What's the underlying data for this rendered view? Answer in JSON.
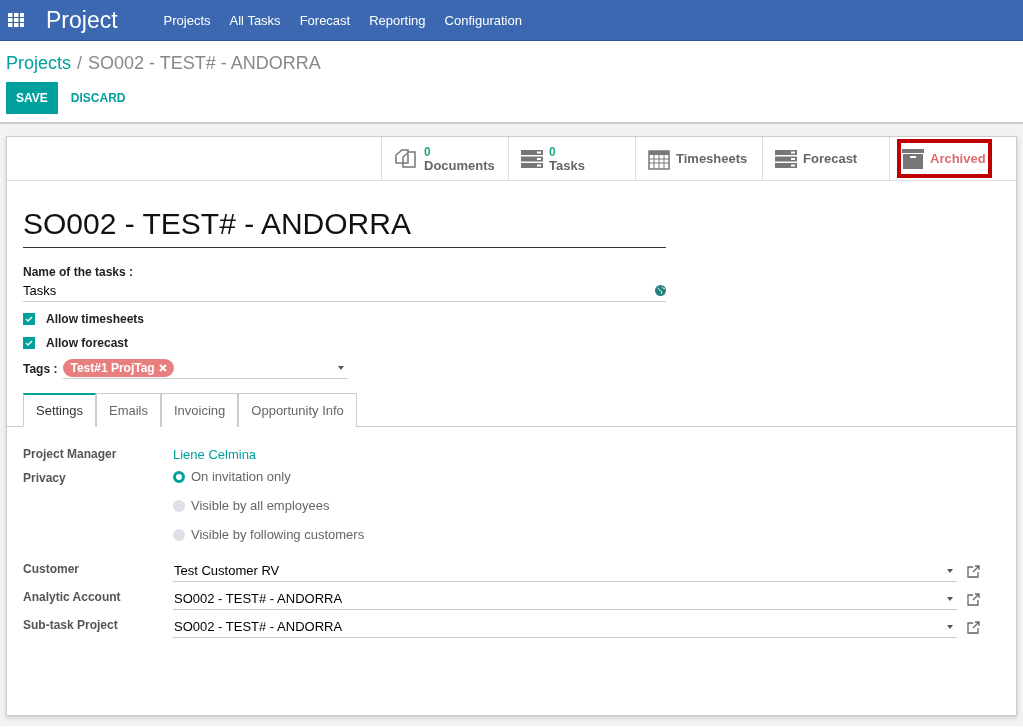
{
  "app": {
    "title": "Project"
  },
  "menu": [
    "Projects",
    "All Tasks",
    "Forecast",
    "Reporting",
    "Configuration"
  ],
  "breadcrumb": {
    "parent": "Projects",
    "separator": "/",
    "current": "SO002 - TEST# - ANDORRA"
  },
  "actions": {
    "save": "SAVE",
    "discard": "DISCARD"
  },
  "smart_buttons": [
    {
      "kind": "documents",
      "count": "0",
      "label": "Documents",
      "highlighted": false
    },
    {
      "kind": "tasks",
      "count": "0",
      "label": "Tasks",
      "highlighted": false
    },
    {
      "kind": "timesheets",
      "label": "Timesheets",
      "highlighted": false
    },
    {
      "kind": "forecast",
      "label": "Forecast",
      "highlighted": false
    },
    {
      "kind": "archive",
      "label": "Archived",
      "highlighted": true
    }
  ],
  "title": "SO002 - TEST# - ANDORRA",
  "task_name": {
    "label": "Name of the tasks :",
    "value": "Tasks"
  },
  "options": [
    {
      "label": "Allow timesheets",
      "checked": true
    },
    {
      "label": "Allow forecast",
      "checked": true
    }
  ],
  "tags": {
    "label": "Tags :",
    "items": [
      {
        "label": "Test#1 ProjTag",
        "color": "#e87f7f"
      }
    ]
  },
  "tabs": [
    {
      "label": "Settings",
      "selected": true
    },
    {
      "label": "Emails",
      "selected": false
    },
    {
      "label": "Invoicing",
      "selected": false
    },
    {
      "label": "Opportunity Info",
      "selected": false
    }
  ],
  "project_manager": {
    "label": "Project Manager",
    "value": "Liene Celmina"
  },
  "privacy": {
    "label": "Privacy",
    "options": [
      {
        "label": "On invitation only",
        "selected": true
      },
      {
        "label": "Visible by all employees",
        "selected": false
      },
      {
        "label": "Visible by following customers",
        "selected": false
      }
    ]
  },
  "relations": [
    {
      "label": "Customer",
      "value": "Test Customer RV"
    },
    {
      "label": "Analytic Account",
      "value": "SO002 - TEST# - ANDORRA"
    },
    {
      "label": "Sub-task Project",
      "value": "SO002 - TEST# - ANDORRA"
    }
  ]
}
